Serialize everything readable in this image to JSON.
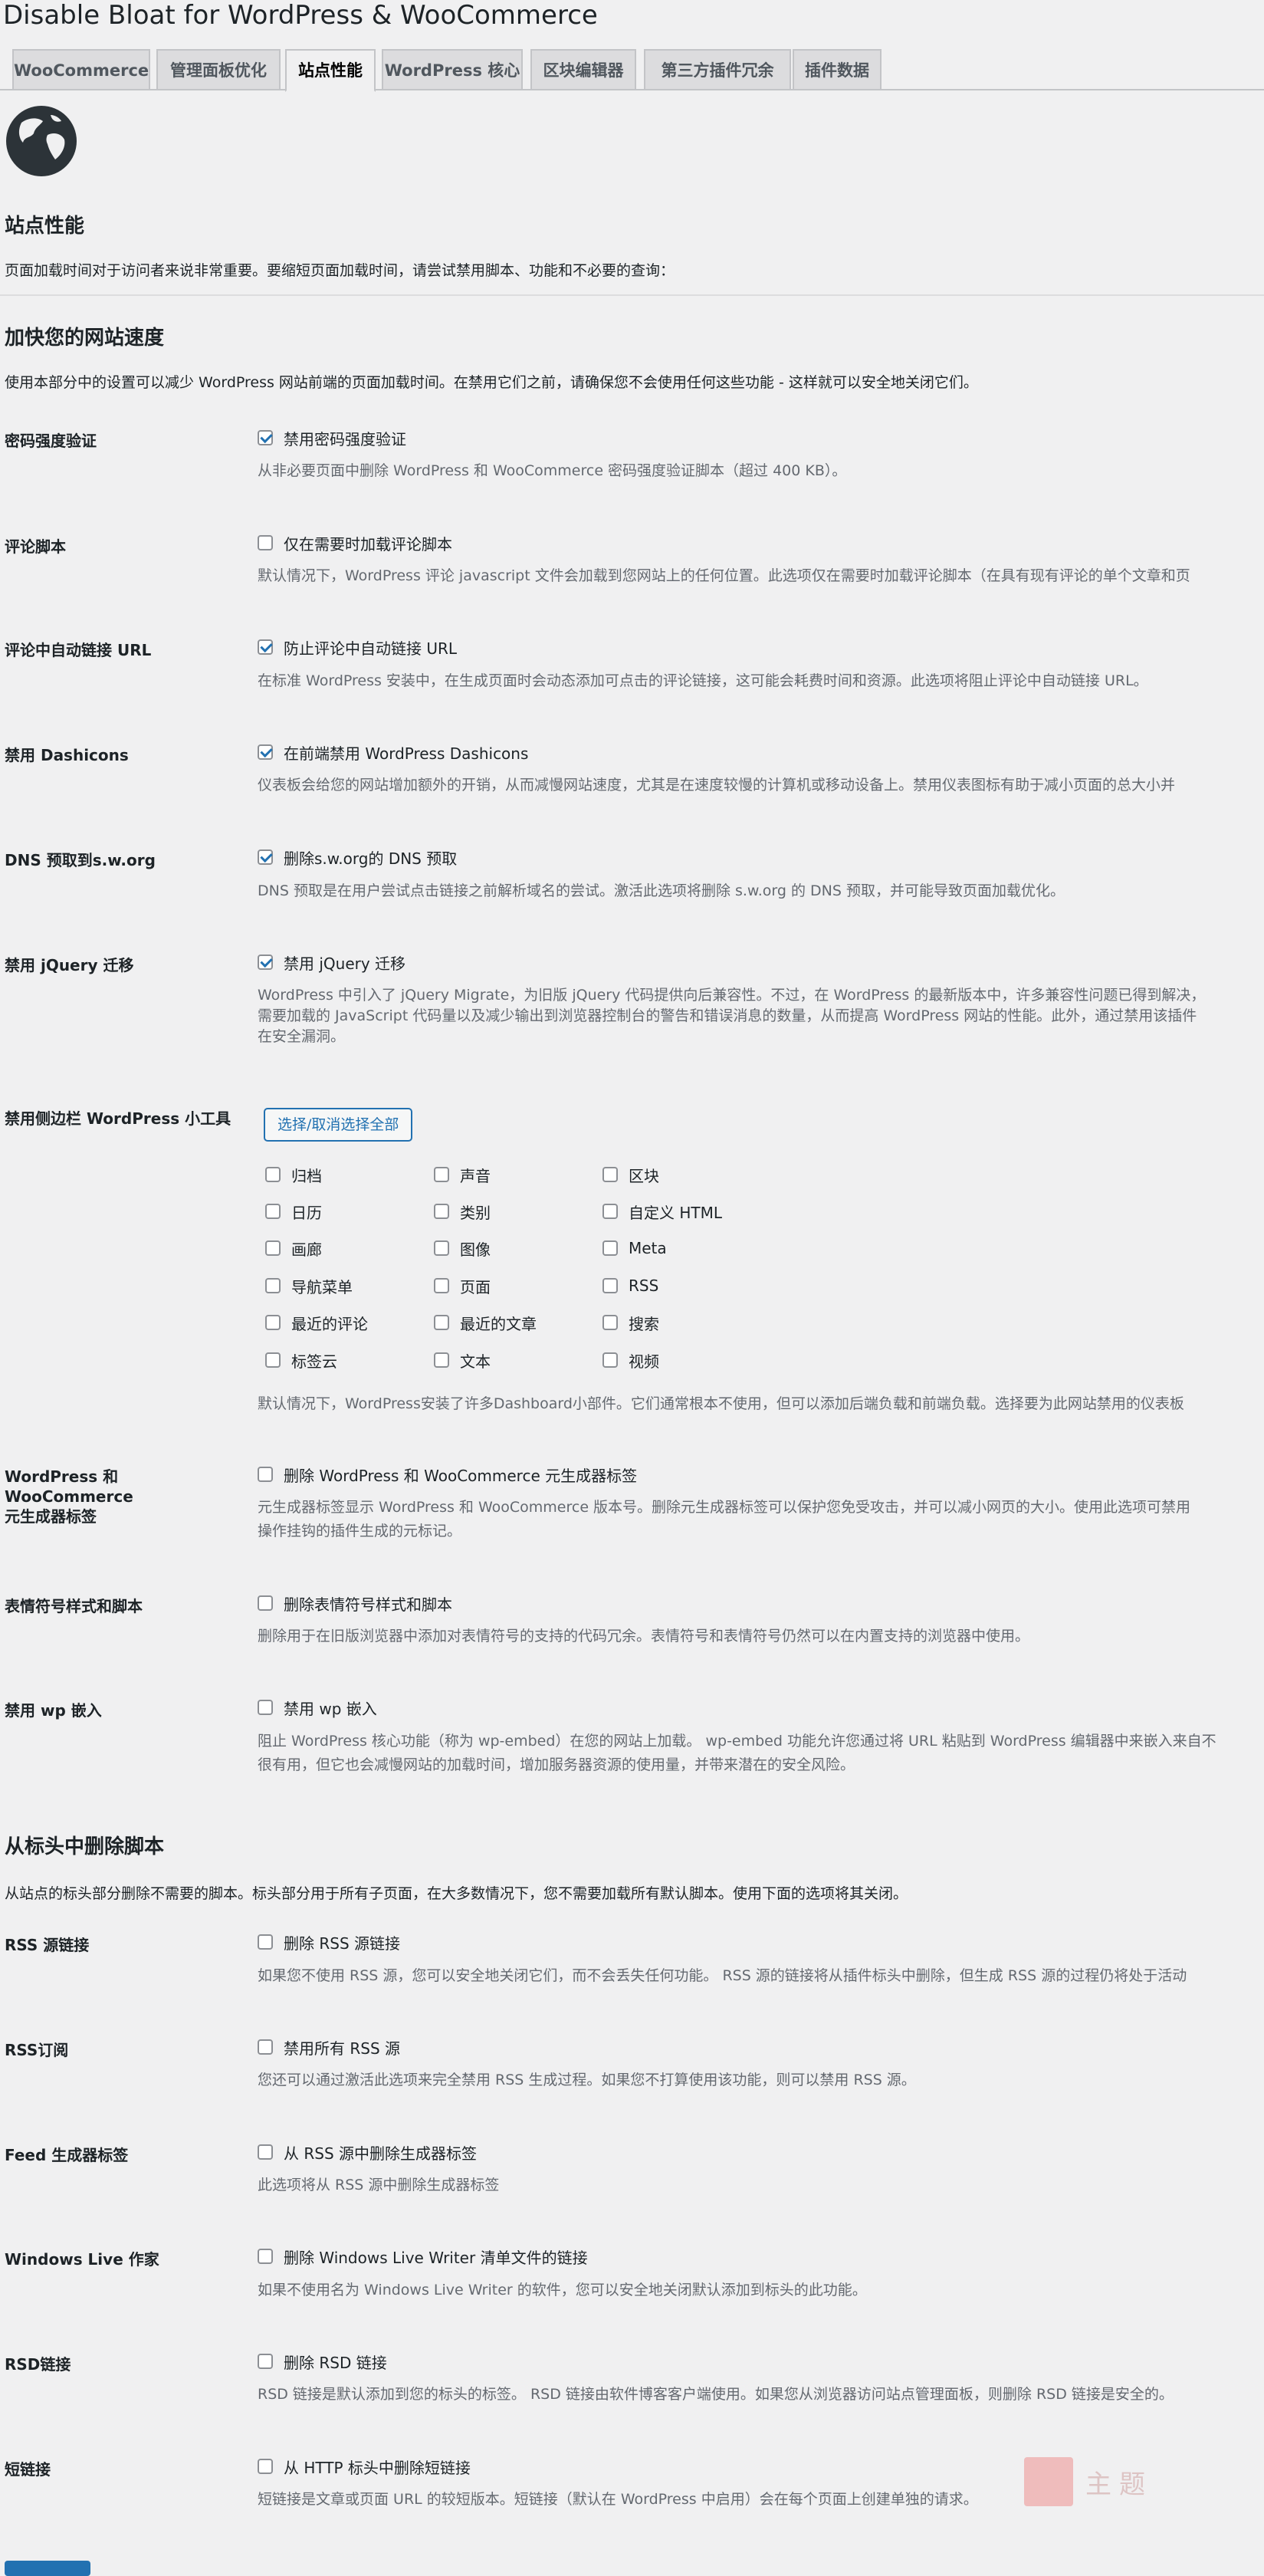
{
  "page_title": "Disable Bloat for WordPress & WooCommerce",
  "tabs": [
    "WooCommerce",
    "管理面板优化",
    "站点性能",
    "WordPress 核心",
    "区块编辑器",
    "第三方插件冗余",
    "插件数据"
  ],
  "active_tab": "站点性能",
  "section_title": "站点性能",
  "section_desc": "页面加载时间对于访问者来说非常重要。要缩短页面加载时间，请尝试禁用脚本、功能和不必要的查询：",
  "speed": {
    "title": "加快您的网站速度",
    "desc": "使用本部分中的设置可以减少 WordPress 网站前端的页面加载时间。在禁用它们之前，请确保您不会使用任何这些功能 - 这样就可以安全地关闭它们。"
  },
  "rows": {
    "password": {
      "label": "密码强度验证",
      "option": "禁用密码强度验证",
      "help": "从非必要页面中删除 WordPress 和 WooCommerce 密码强度验证脚本（超过 400 KB）。"
    },
    "comment_script": {
      "label": "评论脚本",
      "option": "仅在需要时加载评论脚本",
      "help": "默认情况下，WordPress 评论 javascript 文件会加载到您网站上的任何位置。此选项仅在需要时加载评论脚本（在具有现有评论的单个文章和页"
    },
    "autolink": {
      "label": "评论中自动链接 URL",
      "option": "防止评论中自动链接 URL",
      "help": "在标准 WordPress 安装中，在生成页面时会动态添加可点击的评论链接，这可能会耗费时间和资源。此选项将阻止评论中自动链接 URL。"
    },
    "dashicons": {
      "label": "禁用 Dashicons",
      "option": "在前端禁用 WordPress Dashicons",
      "help": "仪表板会给您的网站增加额外的开销，从而减慢网站速度，尤其是在速度较慢的计算机或移动设备上。禁用仪表图标有助于减小页面的总大小并"
    },
    "dns": {
      "label": "DNS 预取到s.w.org",
      "option": "删除s.w.org的 DNS 预取",
      "help": "DNS 预取是在用户尝试点击链接之前解析域名的尝试。激活此选项将删除 s.w.org 的 DNS 预取，并可能导致页面加载优化。"
    },
    "jquery": {
      "label": "禁用 jQuery 迁移",
      "option": "禁用 jQuery 迁移",
      "help1": "WordPress 中引入了 jQuery Migrate，为旧版 jQuery 代码提供向后兼容性。不过，在 WordPress 的最新版本中，许多兼容性问题已得到解决，",
      "help2": "需要加载的 JavaScript 代码量以及减少输出到浏览器控制台的警告和错误消息的数量，从而提高 WordPress 网站的性能。此外，通过禁用该插件",
      "help3": "在安全漏洞。"
    },
    "widgets": {
      "label": "禁用侧边栏 WordPress 小工具",
      "button": "选择/取消选择全部",
      "items": [
        "归档",
        "声音",
        "区块",
        "日历",
        "类别",
        "自定义 HTML",
        "画廊",
        "图像",
        "Meta",
        "导航菜单",
        "页面",
        "RSS",
        "最近的评论",
        "最近的文章",
        "搜索",
        "标签云",
        "文本",
        "视频"
      ],
      "help": "默认情况下，WordPress安装了许多Dashboard小部件。它们通常根本不使用，但可以添加后端负载和前端负载。选择要为此网站禁用的仪表板"
    },
    "generator": {
      "label1": "WordPress 和 WooCommerce",
      "label2": "元生成器标签",
      "option": "删除 WordPress 和 WooCommerce 元生成器标签",
      "help1": "元生成器标签显示 WordPress 和 WooCommerce 版本号。删除元生成器标签可以保护您免受攻击，并可以减小网页的大小。使用此选项可禁用",
      "help2": "操作挂钩的插件生成的元标记。"
    },
    "emoji": {
      "label": "表情符号样式和脚本",
      "option": "删除表情符号样式和脚本",
      "help": "删除用于在旧版浏览器中添加对表情符号的支持的代码冗余。表情符号和表情符号仍然可以在内置支持的浏览器中使用。"
    },
    "embed": {
      "label": "禁用 wp 嵌入",
      "option": "禁用 wp 嵌入",
      "help1": "阻止 WordPress 核心功能（称为 wp-embed）在您的网站上加载。 wp-embed 功能允许您通过将 URL 粘贴到 WordPress 编辑器中来嵌入来自不",
      "help2": "很有用，但它也会减慢网站的加载时间，增加服务器资源的使用量，并带来潜在的安全风险。"
    }
  },
  "header": {
    "title": "从标头中删除脚本",
    "desc": "从站点的标头部分删除不需要的脚本。标头部分用于所有子页面，在大多数情况下，您不需要加载所有默认脚本。使用下面的选项将其关闭。"
  },
  "header_rows": {
    "rss_link": {
      "label": "RSS 源链接",
      "option": "删除 RSS 源链接",
      "help": "如果您不使用 RSS 源，您可以安全地关闭它们，而不会丢失任何功能。 RSS 源的链接将从插件标头中删除，但生成 RSS 源的过程仍将处于活动"
    },
    "rss_sub": {
      "label": "RSS订阅",
      "option": "禁用所有 RSS 源",
      "help": "您还可以通过激活此选项来完全禁用 RSS 生成过程。如果您不打算使用该功能，则可以禁用 RSS 源。"
    },
    "feed_gen": {
      "label": "Feed 生成器标签",
      "option": "从 RSS 源中删除生成器标签",
      "help": "此选项将从 RSS 源中删除生成器标签"
    },
    "wlw": {
      "label": "Windows Live 作家",
      "option": "删除 Windows Live Writer 清单文件的链接",
      "help": "如果不使用名为 Windows Live Writer 的软件，您可以安全地关闭默认添加到标头的此功能。"
    },
    "rsd": {
      "label": "RSD链接",
      "option": "删除 RSD 链接",
      "help": "RSD 链接是默认添加到您的标头的标签。 RSD 链接由软件博客客户端使用。如果您从浏览器访问站点管理面板，则删除 RSD 链接是安全的。"
    },
    "shortlink": {
      "label": "短链接",
      "option": "从 HTTP 标头中删除短链接",
      "help": "短链接是文章或页面 URL 的较短版本。短链接（默认在 WordPress 中启用）会在每个页面上创建单独的请求。"
    }
  },
  "watermark_text": "主题",
  "colors": {
    "accent": "#2271b1",
    "muted": "#646970",
    "bg": "#f0f0f1"
  }
}
